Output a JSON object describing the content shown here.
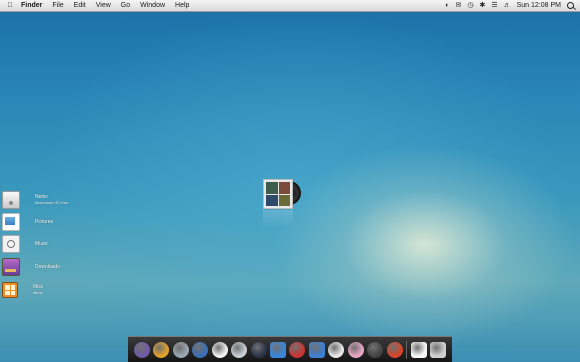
{
  "menubar": {
    "apple": "",
    "items": [
      "Finder",
      "File",
      "Edit",
      "View",
      "Go",
      "Window",
      "Help"
    ],
    "clock": "Sun 12:08 PM"
  },
  "desktop": {
    "icons": [
      {
        "label": "Neiko",
        "sub": "Macintosh HD free",
        "type": "hd"
      },
      {
        "label": "Pictures",
        "sub": "",
        "type": "pictures"
      },
      {
        "label": "Music",
        "sub": "",
        "type": "music"
      },
      {
        "label": "Downloads",
        "sub": "",
        "type": "downloads"
      },
      {
        "label": "Misc",
        "sub": "items",
        "type": "misc"
      }
    ]
  },
  "dock": {
    "colors": [
      "#6f5aa8",
      "#e0a12b",
      "#9aa7b3",
      "#3a6fb8",
      "#f1f1f1",
      "#c9ced4",
      "#2a3448",
      "#3a85d8",
      "#cc3333",
      "#3d7fd1",
      "#e8e8e8",
      "#e9a6c4",
      "#444444",
      "#d8442a",
      "#f6f6f6",
      "#d0d0d0"
    ]
  },
  "colors": {
    "menubar_bg": "#e6e6e6",
    "desktop_top": "#1b6fa7",
    "desktop_glow": "#ebf0d7"
  }
}
